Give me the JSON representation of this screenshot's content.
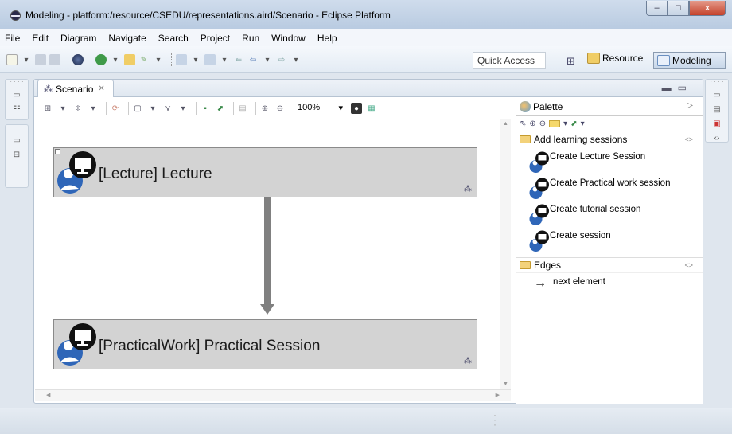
{
  "window": {
    "title": "Modeling - platform:/resource/CSEDU/representations.aird/Scenario - Eclipse Platform",
    "controls": {
      "minimize": "–",
      "maximize": "□",
      "close": "x"
    }
  },
  "menu": [
    "File",
    "Edit",
    "Diagram",
    "Navigate",
    "Search",
    "Project",
    "Run",
    "Window",
    "Help"
  ],
  "toolbar": {
    "quick_access": "Quick Access",
    "perspectives": {
      "resource": "Resource",
      "modeling": "Modeling"
    }
  },
  "editor": {
    "tab_label": "Scenario",
    "zoom": "100%"
  },
  "diagram": {
    "nodes": [
      {
        "label": "[Lecture] Lecture"
      },
      {
        "label": "[PracticalWork] Practical Session"
      }
    ]
  },
  "palette": {
    "title": "Palette",
    "drawers": [
      {
        "label": "Add learning sessions",
        "entries": [
          "Create Lecture Session",
          "Create Practical work session",
          "Create tutorial session",
          "Create session"
        ]
      },
      {
        "label": "Edges",
        "entries": [
          "next element"
        ]
      }
    ]
  },
  "colors": {
    "node_fill": "#d3d3d3",
    "edge": "#808080",
    "person_blue": "#2f66b8",
    "monitor_black": "#111111"
  }
}
